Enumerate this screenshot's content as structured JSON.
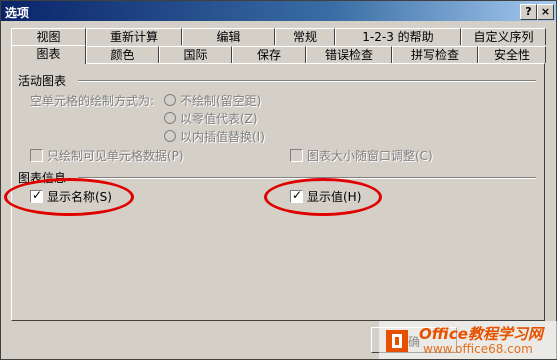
{
  "window": {
    "title": "选项",
    "help_label": "?",
    "close_label": "×"
  },
  "tabs_row1": [
    "视图",
    "重新计算",
    "编辑",
    "常规",
    "1-2-3 的帮助",
    "自定义序列"
  ],
  "tabs_row2": [
    "图表",
    "颜色",
    "国际",
    "保存",
    "错误检查",
    "拼写检查",
    "安全性"
  ],
  "active_tab": "图表",
  "active_chart": {
    "title": "活动图表",
    "empty_cells_label": "空单元格的绘制方式为:",
    "options": [
      "不绘制(留空距)",
      "以零值代表(Z)",
      "以内插值替换(I)"
    ],
    "plot_visible_only": "只绘制可见单元格数据(P)",
    "chart_sizes_with_window": "图表大小随窗口调整(C)"
  },
  "chart_tips": {
    "title": "图表信息",
    "show_names_label": "显示名称(S)",
    "show_names_checked": true,
    "show_values_label": "显示值(H)",
    "show_values_checked": true
  },
  "ok_button": {
    "label": "确"
  },
  "watermark": {
    "line1": "Office教程学习网",
    "line2": "www.office68.com"
  }
}
